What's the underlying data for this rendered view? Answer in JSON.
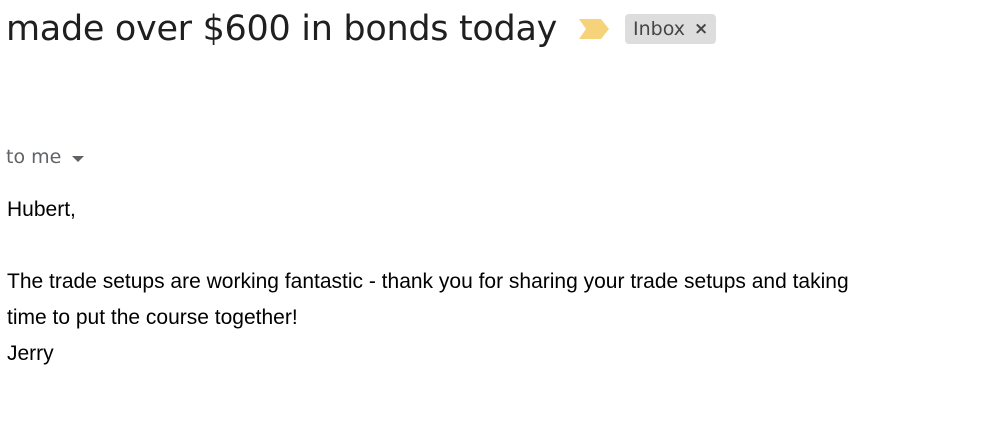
{
  "email": {
    "subject": "made over $600 in bonds today",
    "importance_icon": "importance-marker-icon",
    "label": "Inbox",
    "label_close_glyph": "×",
    "recipient_text": "to me",
    "body": {
      "greeting": "Hubert,",
      "line1": "The trade setups are working fantastic - thank you for sharing your trade setups and taking",
      "line2": "time to put the course together!",
      "signature": "Jerry"
    }
  },
  "colors": {
    "importance": "#f6d37a",
    "label_bg": "#dddddd",
    "muted_text": "#5f6368"
  }
}
